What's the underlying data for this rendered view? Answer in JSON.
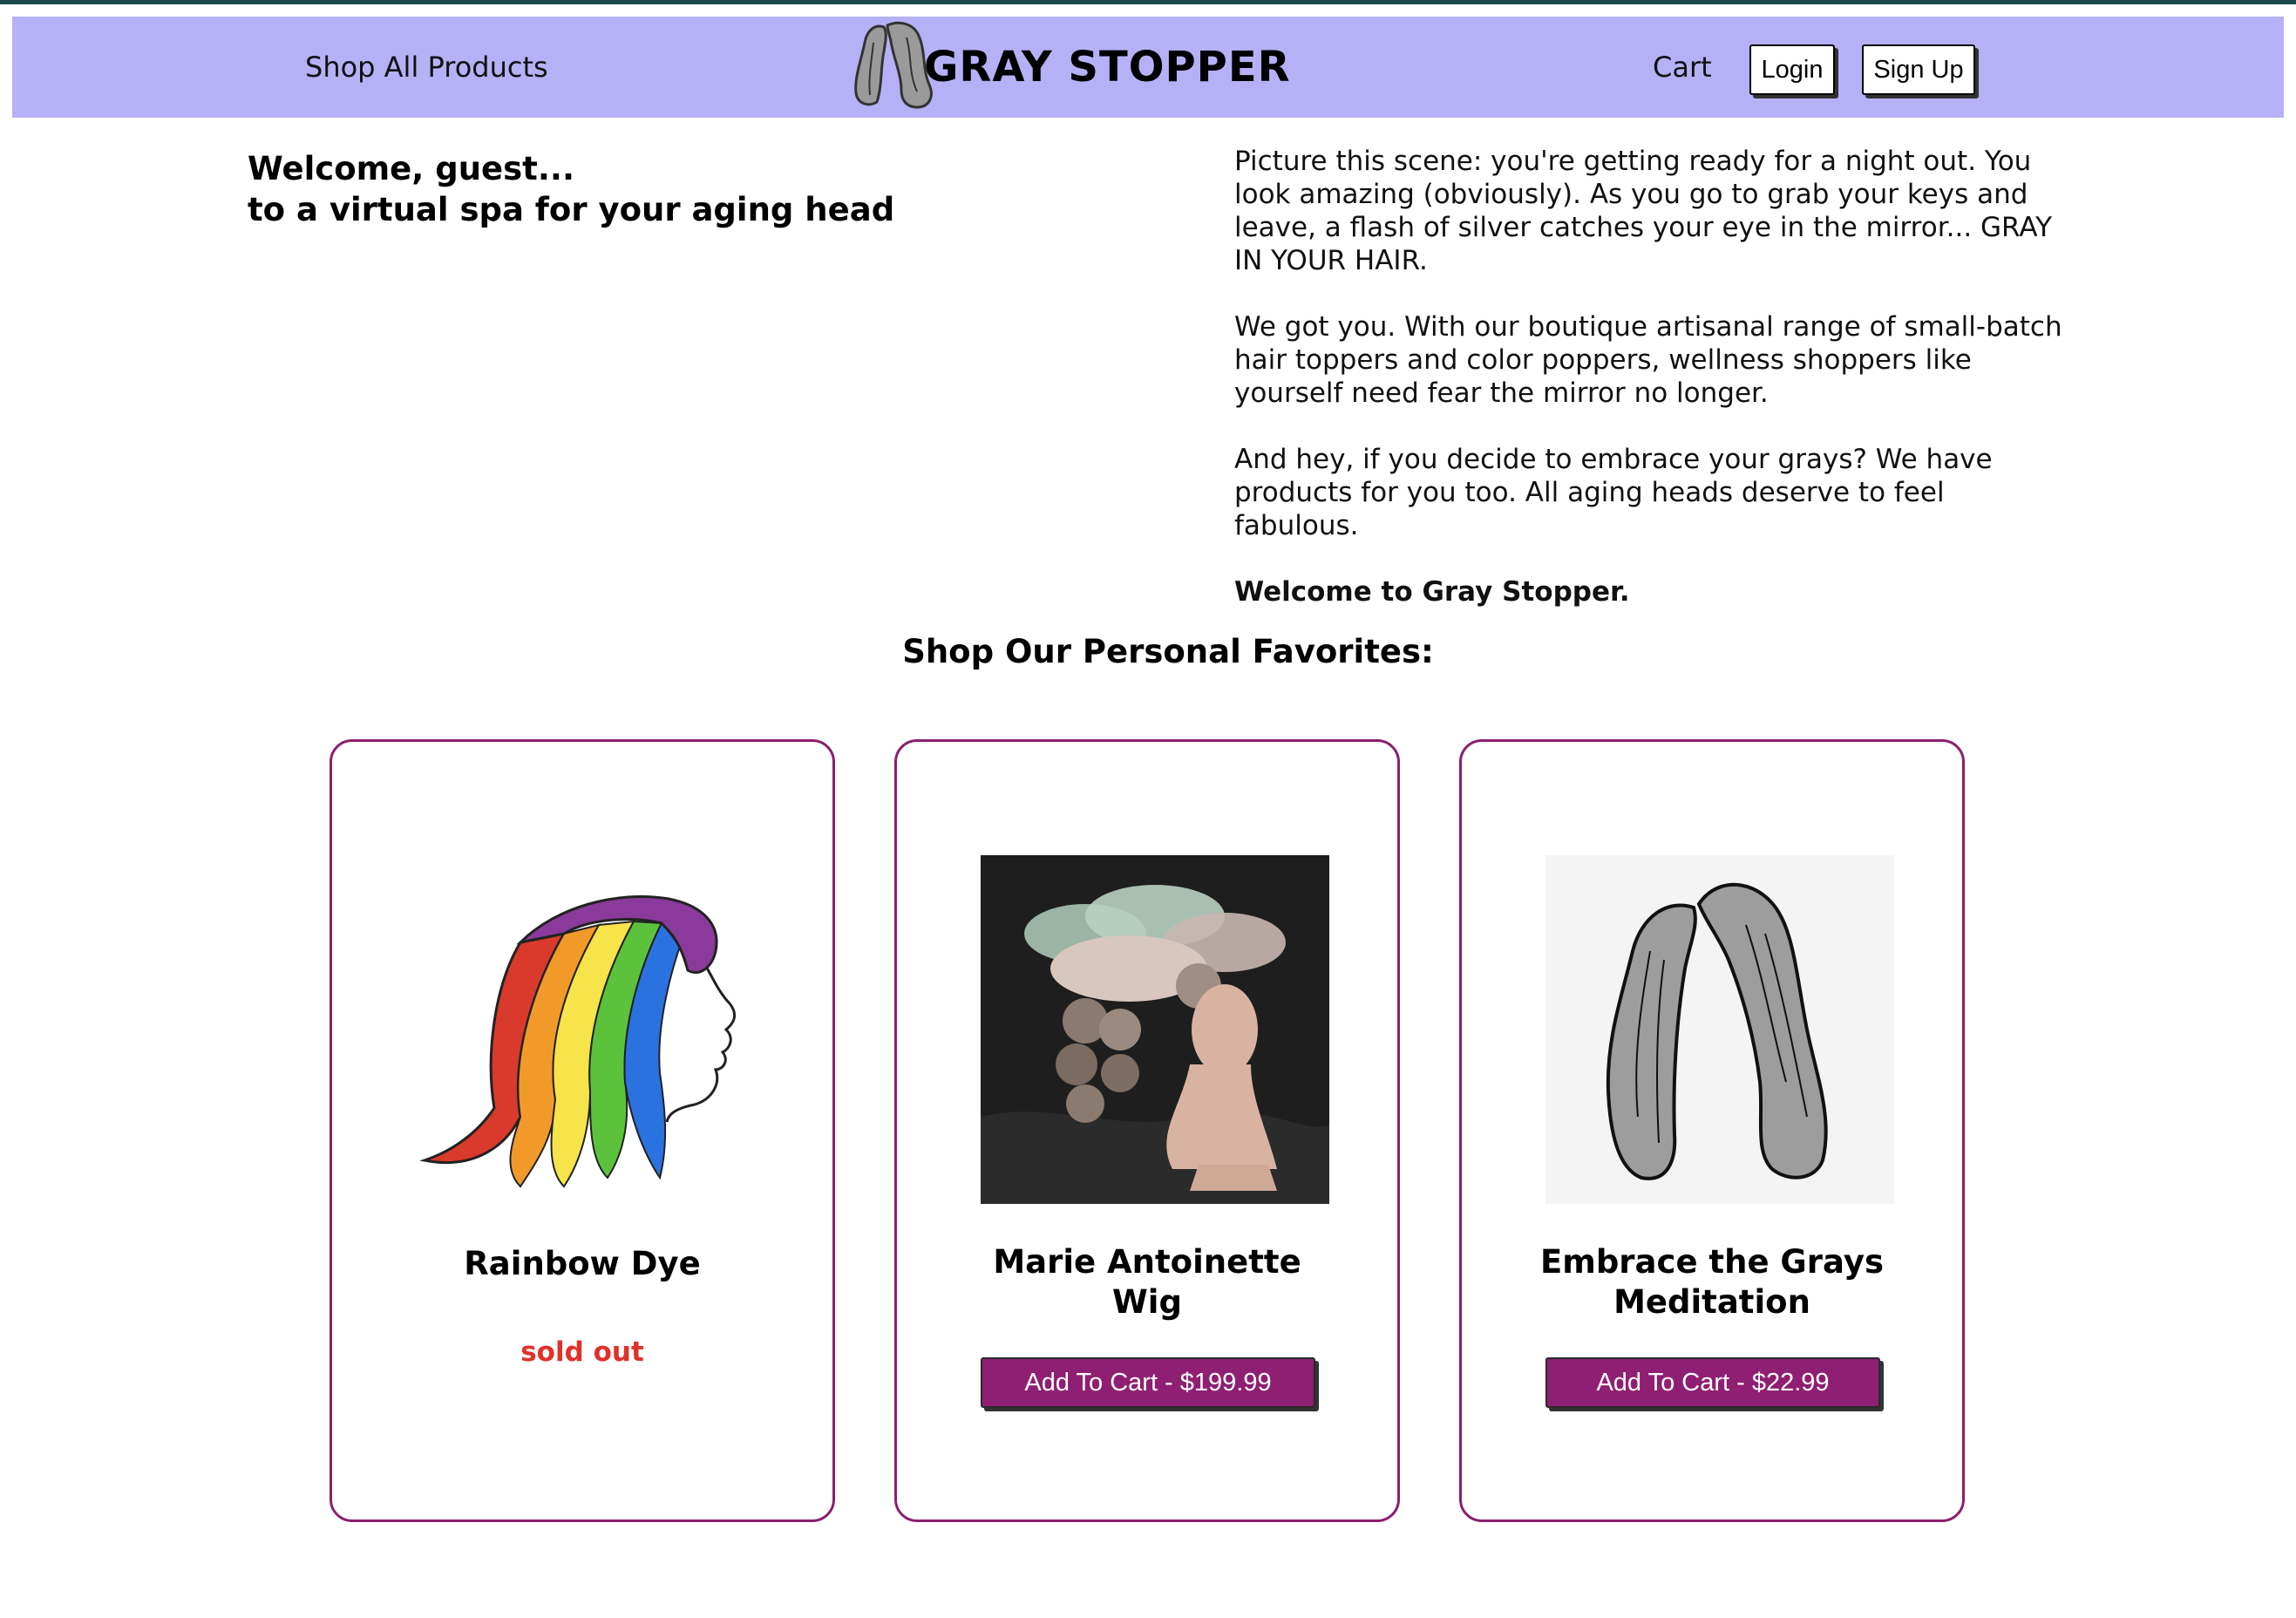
{
  "nav": {
    "shop_all": "Shop All Products",
    "brand": "GRAY STOPPER",
    "cart": "Cart",
    "login": "Login",
    "signup": "Sign Up"
  },
  "hero": {
    "welcome_line1": "Welcome, guest...",
    "welcome_line2": "to a virtual spa for your aging head",
    "paragraphs": [
      "Picture this scene: you're getting ready for a night out. You look amazing (obviously). As you go to grab your keys and leave, a flash of silver catches your eye in the mirror... GRAY IN YOUR HAIR.",
      "We got you. With our boutique artisanal range of small-batch hair toppers and color poppers, wellness shoppers like yourself need fear the mirror no longer.",
      "And hey, if you decide to embrace your grays? We have products for you too. All aging heads deserve to feel fabulous.",
      "Welcome to Gray Stopper."
    ]
  },
  "favorites": {
    "title": "Shop Our Personal Favorites:",
    "products": [
      {
        "name": "Rainbow Dye",
        "status": "sold out"
      },
      {
        "name_line1": "Marie Antoinette",
        "name_line2": "Wig",
        "button": "Add To Cart - $199.99"
      },
      {
        "name_line1": "Embrace the Grays",
        "name_line2": "Meditation",
        "button": "Add To Cart - $22.99"
      }
    ]
  },
  "colors": {
    "navbar": "#b6b1f7",
    "accent": "#8f1f72",
    "sold_out": "#e0302a"
  }
}
